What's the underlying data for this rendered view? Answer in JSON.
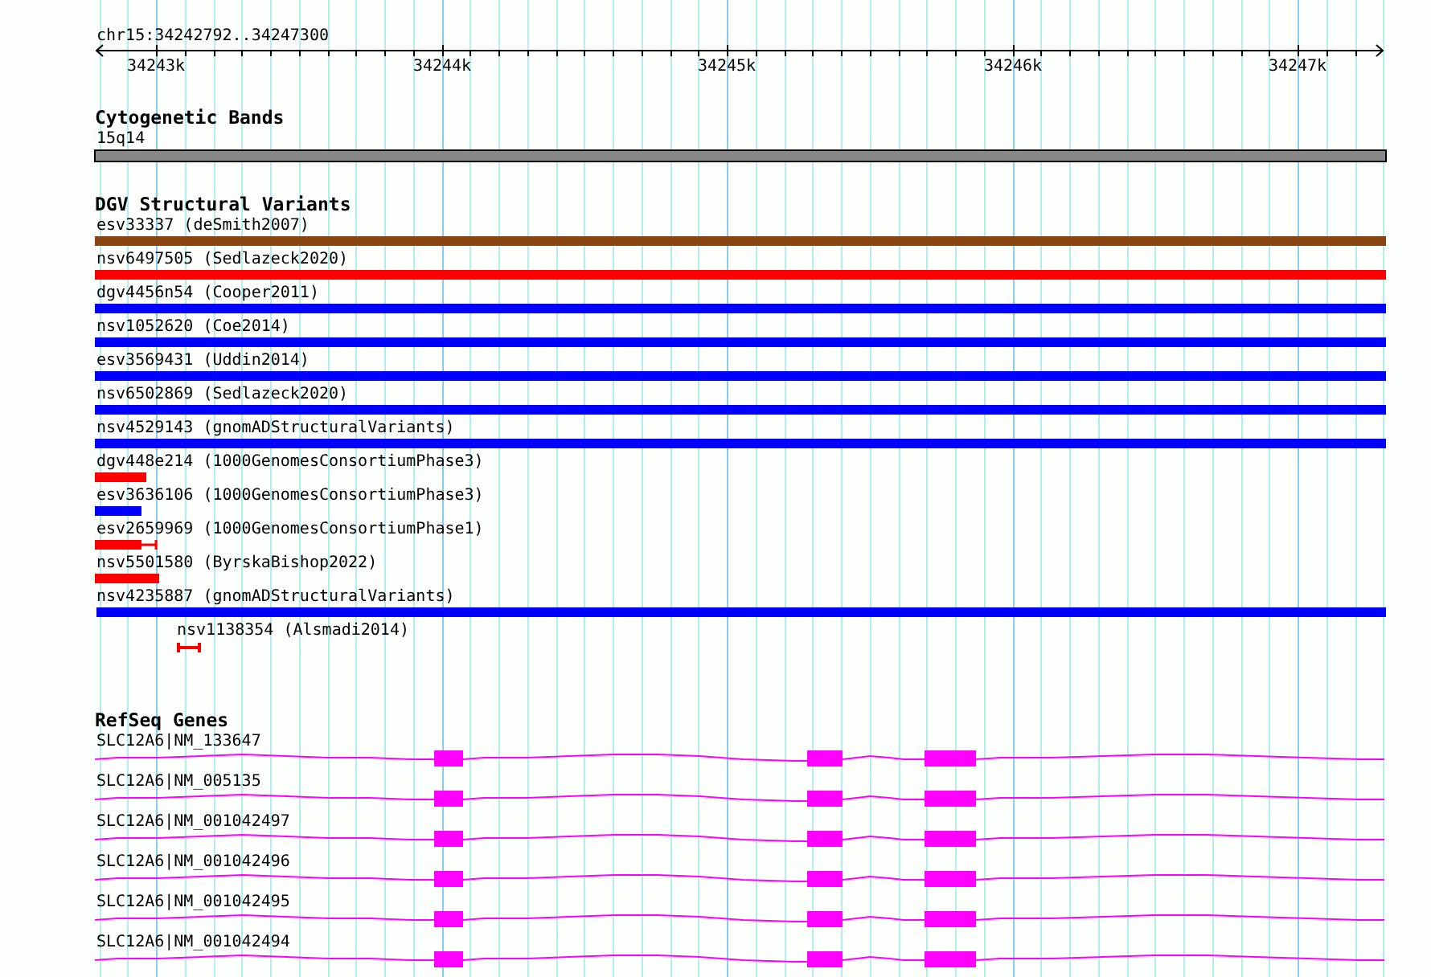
{
  "ruler": {
    "location": "chr15:34242792..34247300",
    "tick_labels": [
      "34243k",
      "34244k",
      "34245k",
      "34246k",
      "34247k"
    ]
  },
  "tracks": [
    {
      "kind": "bands",
      "title": "Cytogenetic Bands",
      "features": [
        {
          "label": "15q14",
          "color": "#888888"
        }
      ]
    },
    {
      "kind": "variants",
      "title": "DGV Structural Variants",
      "features": [
        {
          "label": "esv33337 (deSmith2007)",
          "color": "#8b4513"
        },
        {
          "label": "nsv6497505 (Sedlazeck2020)",
          "color": "#ff0000"
        },
        {
          "label": "dgv4456n54 (Cooper2011)",
          "color": "#0000ff"
        },
        {
          "label": "nsv1052620 (Coe2014)",
          "color": "#0000ff"
        },
        {
          "label": "esv3569431 (Uddin2014)",
          "color": "#0000ff"
        },
        {
          "label": "nsv6502869 (Sedlazeck2020)",
          "color": "#0000ff"
        },
        {
          "label": "nsv4529143 (gnomADStructuralVariants)",
          "color": "#0000ff"
        },
        {
          "label": "dgv448e214 (1000GenomesConsortiumPhase3)",
          "color": "#ff0000"
        },
        {
          "label": "esv3636106 (1000GenomesConsortiumPhase3)",
          "color": "#0000ff"
        },
        {
          "label": "esv2659969 (1000GenomesConsortiumPhase1)",
          "color": "#ff0000"
        },
        {
          "label": "nsv5501580 (ByrskaBishop2022)",
          "color": "#ff0000"
        },
        {
          "label": "nsv4235887 (gnomADStructuralVariants)",
          "color": "#0000ff"
        },
        {
          "label": "nsv1138354 (Alsmadi2014)",
          "color": "#ff0000"
        }
      ]
    },
    {
      "kind": "genes",
      "title": "RefSeq Genes",
      "features": [
        {
          "label": "SLC12A6|NM_133647"
        },
        {
          "label": "SLC12A6|NM_005135"
        },
        {
          "label": "SLC12A6|NM_001042497"
        },
        {
          "label": "SLC12A6|NM_001042496"
        },
        {
          "label": "SLC12A6|NM_001042495"
        },
        {
          "label": "SLC12A6|NM_001042494"
        }
      ]
    }
  ]
}
